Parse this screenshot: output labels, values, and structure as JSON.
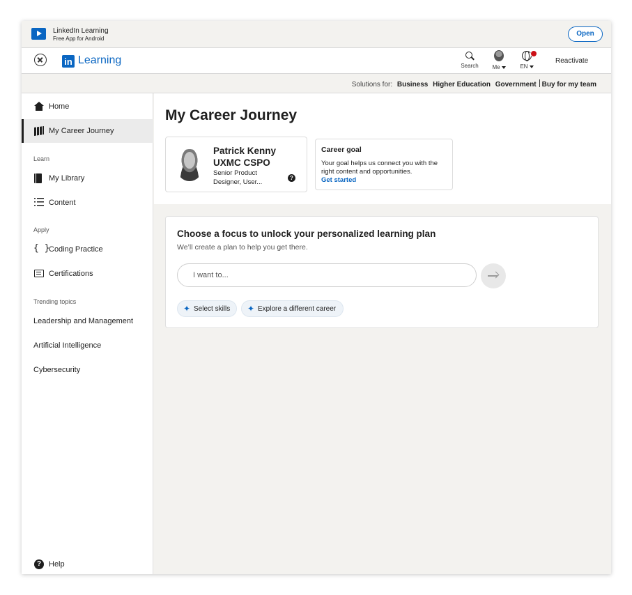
{
  "banner": {
    "app_name": "LinkedIn Learning",
    "app_sub": "Free App for Android",
    "open_label": "Open"
  },
  "header": {
    "logo_mark": "in",
    "logo_text": "Learning",
    "search_label": "Search",
    "me_label": "Me",
    "lang_label": "EN",
    "reactivate_label": "Reactivate"
  },
  "solutions": {
    "label": "Solutions for:",
    "links": [
      "Business",
      "Higher Education",
      "Government",
      "Buy for my team"
    ]
  },
  "sidebar": {
    "home": "Home",
    "career": "My Career Journey",
    "learn_heading": "Learn",
    "library": "My Library",
    "content": "Content",
    "apply_heading": "Apply",
    "coding": "Coding Practice",
    "certs": "Certifications",
    "trending_heading": "Trending topics",
    "trending": [
      "Leadership and Management",
      "Artificial Intelligence",
      "Cybersecurity"
    ],
    "help": "Help"
  },
  "main": {
    "title": "My Career Journey",
    "profile": {
      "name": "Patrick Kenny UXMC CSPO",
      "headline": "Senior Product Designer, User..."
    },
    "goal": {
      "title": "Career goal",
      "desc": "Your goal helps us connect you with the right content and opportunities.",
      "link": "Get started"
    },
    "focus": {
      "title": "Choose a focus to unlock your personalized learning plan",
      "subtitle": "We’ll create a plan to help you get there.",
      "placeholder": "I want to...",
      "chips": [
        "Select skills",
        "Explore a different career"
      ]
    }
  },
  "icons": {
    "accent": "#0a66c2",
    "notification": "#cc1016"
  }
}
